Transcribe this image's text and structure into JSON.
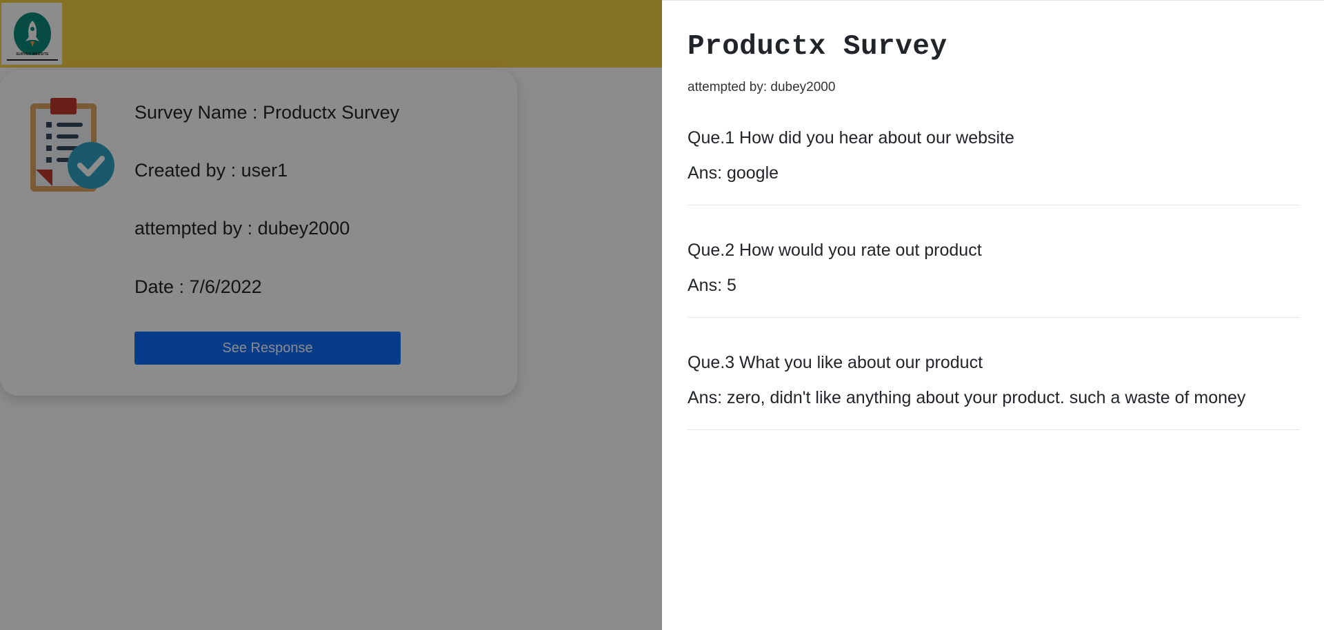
{
  "background": {
    "logo": {
      "alt": "rocket-logo",
      "caption": "SURVEY WEBSITE"
    },
    "card": {
      "survey_name_line": "Survey Name : Productx Survey",
      "created_by_line": "Created by : user1",
      "attempted_by_line": "attempted by : dubey2000",
      "date_line": "Date : 7/6/2022",
      "see_response_label": "See Response"
    }
  },
  "panel": {
    "title": "Productx Survey",
    "attempted_by": "attempted by: dubey2000",
    "questions": [
      {
        "question": "Que.1 How did you hear about our website",
        "answer": "Ans: google"
      },
      {
        "question": "Que.2 How would you rate out product",
        "answer": "Ans: 5"
      },
      {
        "question": "Que.3 What you like about our product",
        "answer": "Ans: zero, didn't like anything about your product. such a waste of money"
      }
    ]
  },
  "colors": {
    "topbar": "#f4cf43",
    "primary_button": "#0d6efd",
    "logo_green": "#0e8a7a",
    "backdrop": "rgba(0,0,0,0.45)"
  },
  "icons": [
    "rocket-logo-icon",
    "clipboard-check-icon"
  ]
}
